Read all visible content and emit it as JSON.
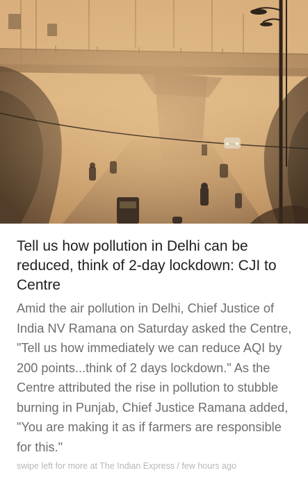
{
  "hero_image": {
    "alt": "Smog over a flyover in Delhi with traffic",
    "icon": "photo-icon"
  },
  "article": {
    "headline": "Tell us how pollution in Delhi can be reduced, think of 2-day lockdown: CJI to Centre",
    "body": "Amid the air pollution in Delhi, Chief Justice of India NV Ramana on Saturday asked the Centre, \"Tell us how immediately we can reduce AQI by 200 points...think of 2 days lockdown.\" As the Centre attributed the rise in pollution to stubble burning in Punjab, Chief Justice Ramana added, \"You are making it as if farmers are responsible for this.\"",
    "footer": {
      "prefix": "swipe left for more at ",
      "source": "The Indian Express",
      "separator": " / ",
      "time": "few hours ago"
    }
  },
  "colors": {
    "headline": "#1f1f1f",
    "body": "#6d6d6d",
    "footer": "#b7b7b7",
    "smog": "#d6b07a"
  }
}
